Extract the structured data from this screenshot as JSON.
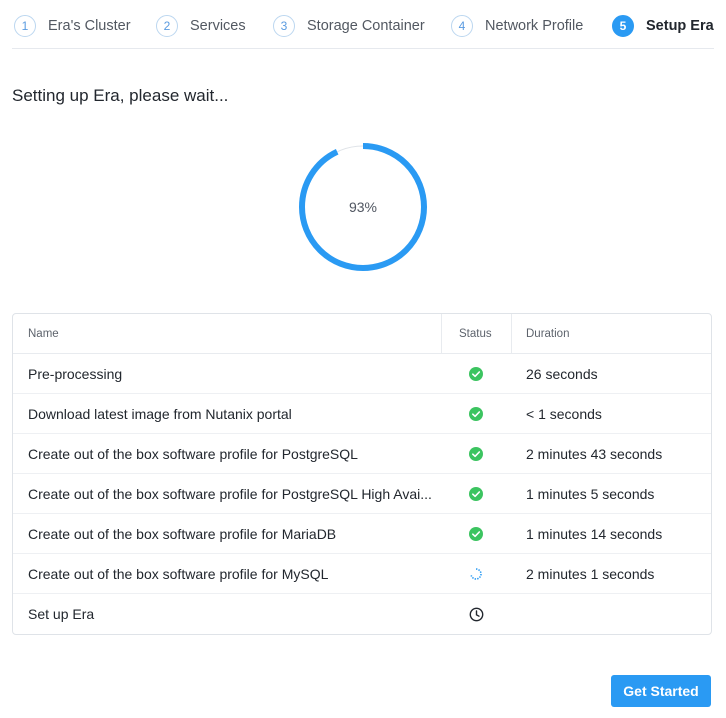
{
  "steps": [
    {
      "num": "1",
      "label": "Era's Cluster"
    },
    {
      "num": "2",
      "label": "Services"
    },
    {
      "num": "3",
      "label": "Storage Container"
    },
    {
      "num": "4",
      "label": "Network Profile"
    },
    {
      "num": "5",
      "label": "Setup Era"
    }
  ],
  "active_step": 5,
  "heading": "Setting up Era, please wait...",
  "progress": {
    "percent": 93,
    "label": "93%",
    "color": "#2a9af3",
    "track_color": "#dfe3e8"
  },
  "table": {
    "headers": {
      "name": "Name",
      "status": "Status",
      "duration": "Duration"
    },
    "rows": [
      {
        "name": "Pre-processing",
        "status": "success",
        "status_icon": "check-circle-icon",
        "duration": "26 seconds"
      },
      {
        "name": "Download latest image from Nutanix portal",
        "status": "success",
        "status_icon": "check-circle-icon",
        "duration": "< 1 seconds"
      },
      {
        "name": "Create out of the box software profile for PostgreSQL",
        "status": "success",
        "status_icon": "check-circle-icon",
        "duration": "2 minutes 43 seconds"
      },
      {
        "name": "Create out of the box software profile for PostgreSQL High Avai...",
        "status": "success",
        "status_icon": "check-circle-icon",
        "duration": "1 minutes 5 seconds"
      },
      {
        "name": "Create out of the box software profile for MariaDB",
        "status": "success",
        "status_icon": "check-circle-icon",
        "duration": "1 minutes 14 seconds"
      },
      {
        "name": "Create out of the box software profile for MySQL",
        "status": "running",
        "status_icon": "spinner-icon",
        "duration": "2 minutes 1 seconds"
      },
      {
        "name": "Set up Era",
        "status": "pending",
        "status_icon": "clock-icon",
        "duration": ""
      }
    ]
  },
  "colors": {
    "success": "#3cc460",
    "running": "#2a9af3",
    "pending": "#22272e"
  },
  "button": {
    "label": "Get Started"
  }
}
